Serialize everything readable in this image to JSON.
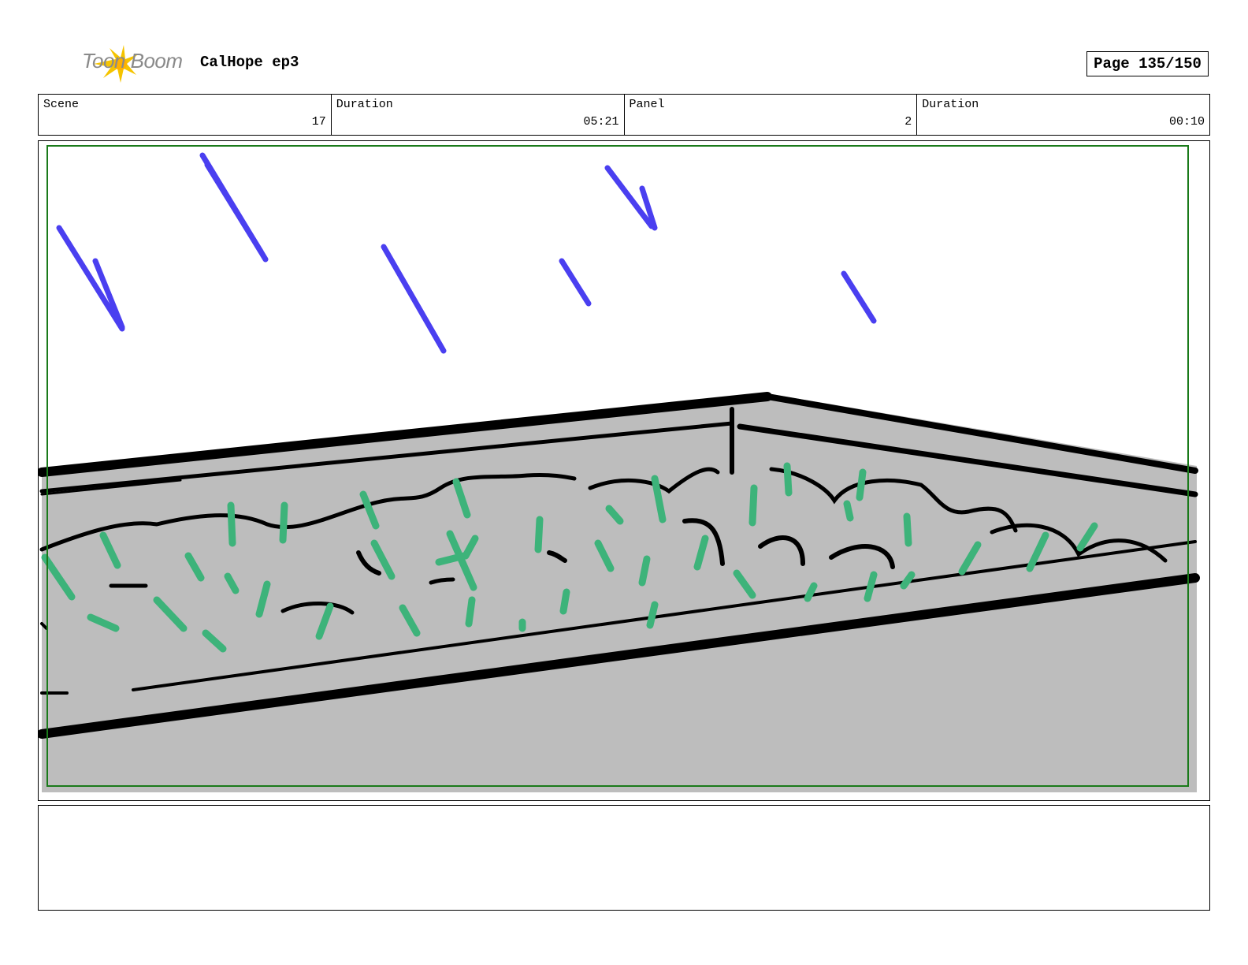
{
  "header": {
    "logo_text": "Toon Boom",
    "project_title": "CalHope ep3",
    "page_label": "Page 135/150"
  },
  "info": [
    {
      "label": "Scene",
      "value": "17"
    },
    {
      "label": "Duration",
      "value": "05:21"
    },
    {
      "label": "Panel",
      "value": "2"
    },
    {
      "label": "Duration",
      "value": "00:10"
    }
  ],
  "colors": {
    "rain": "#4a3ff0",
    "grass": "#3db37a",
    "planter_fill": "#bdbdbd",
    "frame_green": "#1a7a1a",
    "logo_burst": "#f5c400"
  },
  "notes": ""
}
